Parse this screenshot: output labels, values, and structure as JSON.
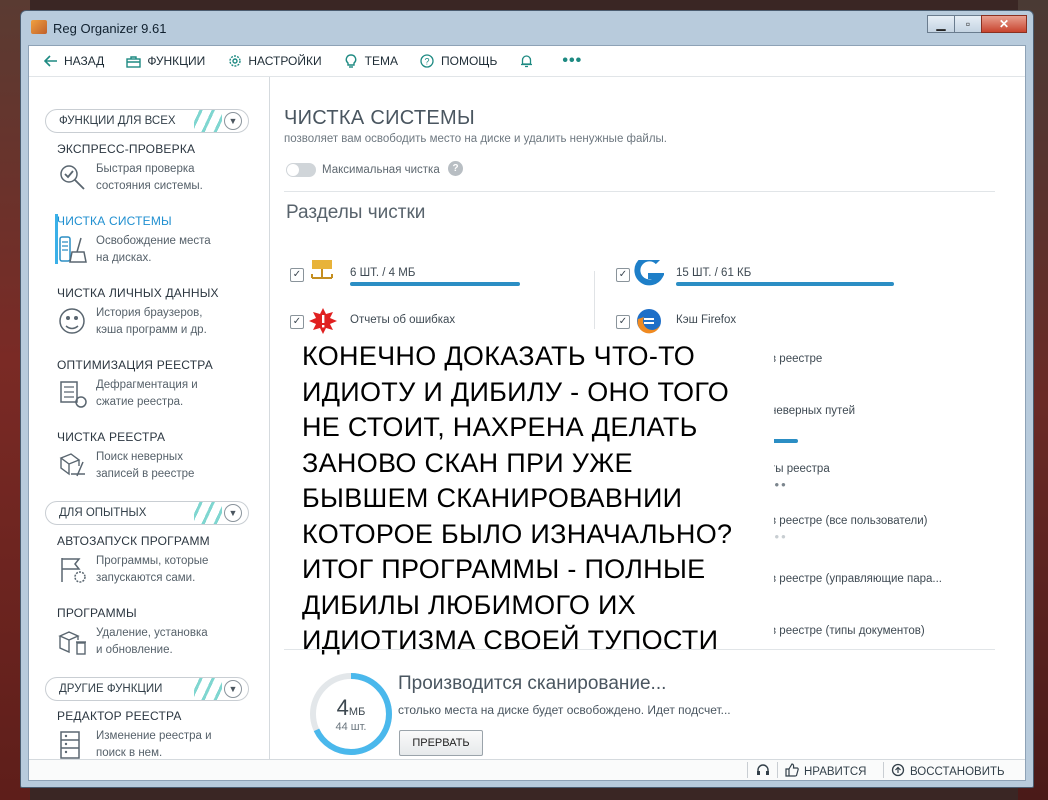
{
  "window": {
    "title": "Reg Organizer 9.61",
    "min": "▁",
    "max": "▫",
    "close": "✕"
  },
  "toolbar": {
    "back": "НАЗАД",
    "functions": "ФУНКЦИИ",
    "settings": "НАСТРОЙКИ",
    "theme": "ТЕМА",
    "help": "ПОМОЩЬ",
    "more": "•••"
  },
  "sidebar": {
    "groups": [
      {
        "label": "ФУНКЦИИ ДЛЯ ВСЕХ"
      },
      {
        "label": "ДЛЯ ОПЫТНЫХ"
      },
      {
        "label": "ДРУГИЕ ФУНКЦИИ"
      }
    ],
    "items": [
      {
        "title": "ЭКСПРЕСС-ПРОВЕРКА",
        "desc1": "Быстрая проверка",
        "desc2": "состояния системы."
      },
      {
        "title": "ЧИСТКА СИСТЕМЫ",
        "desc1": "Освобождение места",
        "desc2": "на дисках."
      },
      {
        "title": "ЧИСТКА ЛИЧНЫХ ДАННЫХ",
        "desc1": "История браузеров,",
        "desc2": "кэша программ и др."
      },
      {
        "title": "ОПТИМИЗАЦИЯ РЕЕСТРА",
        "desc1": "Дефрагментация и",
        "desc2": "сжатие реестра."
      },
      {
        "title": "ЧИСТКА РЕЕСТРА",
        "desc1": "Поиск неверных",
        "desc2": "записей в реестре"
      },
      {
        "title": "АВТОЗАПУСК ПРОГРАММ",
        "desc1": "Программы, которые",
        "desc2": "запускаются сами."
      },
      {
        "title": "ПРОГРАММЫ",
        "desc1": "Удаление, установка",
        "desc2": "и обновление."
      },
      {
        "title": "РЕДАКТОР РЕЕСТРА",
        "desc1": "Изменение реестра и",
        "desc2": "поиск в нем."
      }
    ]
  },
  "main": {
    "title": "ЧИСТКА СИСТЕМЫ",
    "subtitle": "позволяет вам освободить место на диске и удалить ненужные файлы.",
    "toggle_label": "Максимальная чистка",
    "help": "?",
    "section_title": "Разделы чистки",
    "categories": [
      {
        "label": "6 ШТ. / 4 МБ",
        "check": "✓"
      },
      {
        "label": "15 ШТ. / 61 КБ",
        "check": "✓"
      },
      {
        "label": "Отчеты об ошибках",
        "check": "✓"
      },
      {
        "label": "Кэш Firefox",
        "check": "✓"
      }
    ],
    "right_labels": [
      "в реестре",
      "неверных путей",
      "ты реестра",
      "в реестре (все пользователи)",
      "в реестре (управляющие пара...",
      "в реестре (типы документов)"
    ],
    "dots_a": "•••",
    "dots_b": "•••",
    "overlay_text": "КОНЕЧНО ДОКАЗАТЬ ЧТО-ТО\nИДИОТУ И ДИБИЛУ - ОНО ТОГО\nНЕ СТОИТ, НАХРЕНА ДЕЛАТЬ\nЗАНОВО СКАН ПРИ УЖЕ\nБЫВШЕМ СКАНИРОВАВНИИ\nКОТОРОЕ БЫЛО ИЗНАЧАЛЬНО?\nИТОГ ПРОГРАММЫ - ПОЛНЫЕ\nДИБИЛЫ ЛЮБИМОГО ИХ\nИДИОТИЗМА СВОЕЙ ТУПОСТИ",
    "scan": {
      "size_num": "4",
      "size_unit": "МБ",
      "count": "44 шт.",
      "progress": 0.68,
      "title": "Производится сканирование...",
      "subtitle": "столько места на диске будет освобождено. Идет подсчет...",
      "stop": "ПРЕРВАТЬ"
    }
  },
  "status": {
    "like": "НРАВИТСЯ",
    "restore": "ВОССТАНОВИТЬ"
  },
  "colors": {
    "accent": "#1f8fd0",
    "bar": "#2b8ec4",
    "teal": "#1e8a82",
    "ring": "#4ab8ec"
  }
}
